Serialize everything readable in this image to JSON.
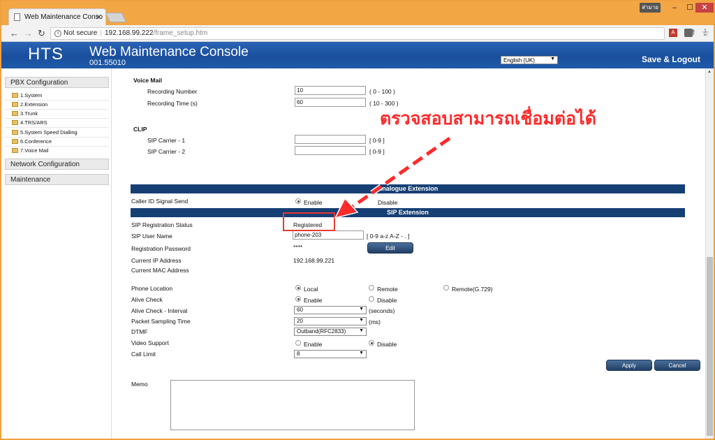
{
  "browser": {
    "tab_title": "Web Maintenance Conso",
    "user_badge": "ส่ามาย",
    "security": "Not secure",
    "url_host": "192.168.99.222",
    "url_path": "/frame_setup.htm"
  },
  "header": {
    "logo": "HTS",
    "title": "Web Maintenance Console",
    "version": "001.55010",
    "language": "English (UK)",
    "save_logout": "Save & Logout"
  },
  "sidebar": {
    "pbx": "PBX Configuration",
    "items": [
      "1.System",
      "2.Extension",
      "3.Trunk",
      "4.TRS/ARS",
      "5.System Speed Dialling",
      "6.Conference",
      "7.Voice Mail"
    ],
    "network": "Network Configuration",
    "maintenance": "Maintenance"
  },
  "voice_mail": {
    "heading": "Voice Mail",
    "rec_number_label": "Recording Number",
    "rec_number_value": "10",
    "rec_number_range": "( 0 - 100 )",
    "rec_time_label": "Recording Time (s)",
    "rec_time_value": "60",
    "rec_time_range": "( 10 - 300 )"
  },
  "clip": {
    "heading": "CLIP",
    "carrier1_label": "SIP Carrier - 1",
    "carrier1_range": "[ 0-9 ]",
    "carrier2_label": "SIP Carrier - 2",
    "carrier2_range": "[ 0-9 ]"
  },
  "analogue": {
    "bar": "Analogue Extension",
    "caller_id_label": "Caller ID Signal Send",
    "enable": "Enable",
    "disable": "Disable"
  },
  "sip": {
    "bar": "SIP Extension",
    "reg_status_label": "SIP Registration Status",
    "reg_status_value": "Registered",
    "user_name_label": "SIP User Name",
    "user_name_value": "phone-203",
    "user_name_range": "[ 0-9 a-z A-Z - . ]",
    "reg_password_label": "Registration Password",
    "reg_password_value": "****",
    "edit": "Edit",
    "ip_label": "Current IP Address",
    "ip_value": "192.168.99.221",
    "mac_label": "Current MAC Address",
    "location_label": "Phone Location",
    "loc_local": "Local",
    "loc_remote": "Remote",
    "loc_remote_g729": "Remote(G.729)",
    "alive_label": "Alive Check",
    "alive_enable": "Enable",
    "alive_disable": "Disable",
    "interval_label": "Alive Check - Interval",
    "interval_value": "60",
    "interval_unit": "(seconds)",
    "packet_label": "Packet Sampling Time",
    "packet_value": "20",
    "packet_unit": "(ms)",
    "dtmf_label": "DTMF",
    "dtmf_value": "Outband(RFC2833)",
    "video_label": "Video Support",
    "video_enable": "Enable",
    "video_disable": "Disable",
    "call_limit_label": "Call Limit",
    "call_limit_value": "8",
    "apply": "Apply",
    "cancel": "Cancel",
    "memo_label": "Memo"
  },
  "annotation": {
    "text": "ตรวจสอบสามารถเชื่อมต่อได้",
    "color": "#ff2a2a"
  }
}
